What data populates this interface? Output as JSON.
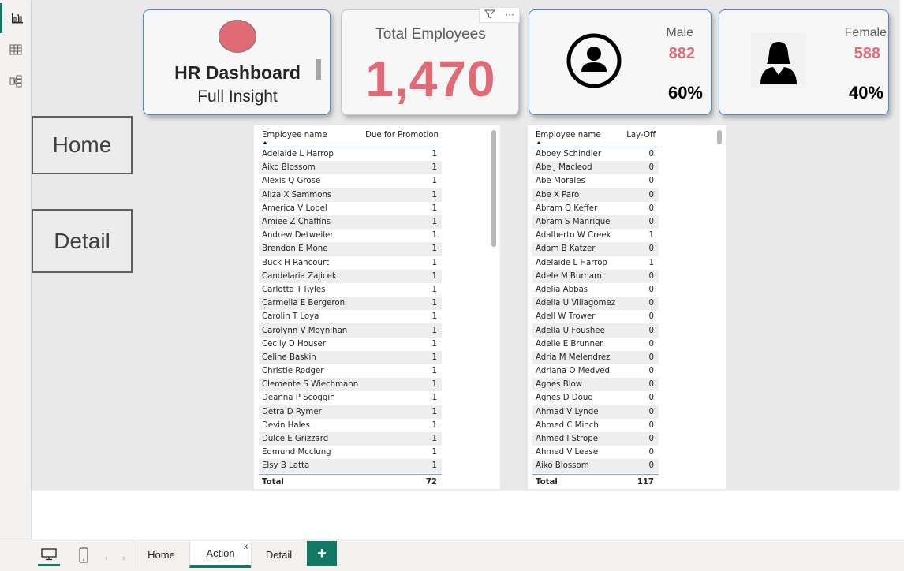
{
  "rail": {
    "icons": [
      "report-view-icon",
      "table-view-icon",
      "model-view-icon"
    ]
  },
  "title_card": {
    "title": "HR Dashboard",
    "subtitle": "Full Insight"
  },
  "total_card": {
    "label": "Total Employees",
    "value": "1,470",
    "tools": {
      "filter_icon": "filter-icon",
      "more_icon": "more-options-icon",
      "more_label": "···"
    }
  },
  "male_card": {
    "label": "Male",
    "count": "882",
    "percent": "60%",
    "icon": "male-user-icon"
  },
  "female_card": {
    "label": "Female",
    "count": "588",
    "percent": "40%",
    "icon": "female-user-icon"
  },
  "nav": {
    "home": "Home",
    "detail": "Detail"
  },
  "promotion_table": {
    "headers": [
      "Employee name",
      "Due for Promotion"
    ],
    "rows": [
      [
        "Adelaide L Harrop",
        "1"
      ],
      [
        "Aiko Blossom",
        "1"
      ],
      [
        "Alexis Q Grose",
        "1"
      ],
      [
        "Aliza X Sammons",
        "1"
      ],
      [
        "America V Lobel",
        "1"
      ],
      [
        "Amiee Z Chaffins",
        "1"
      ],
      [
        "Andrew Detweiler",
        "1"
      ],
      [
        "Brendon E Mone",
        "1"
      ],
      [
        "Buck H Rancourt",
        "1"
      ],
      [
        "Candelaria Zajicek",
        "1"
      ],
      [
        "Carlotta T Ryles",
        "1"
      ],
      [
        "Carmella E Bergeron",
        "1"
      ],
      [
        "Carolin T Loya",
        "1"
      ],
      [
        "Carolynn V Moynihan",
        "1"
      ],
      [
        "Cecily D Houser",
        "1"
      ],
      [
        "Celine Baskin",
        "1"
      ],
      [
        "Christie Rodger",
        "1"
      ],
      [
        "Clemente S Wiechmann",
        "1"
      ],
      [
        "Deanna P Scoggin",
        "1"
      ],
      [
        "Detra D Rymer",
        "1"
      ],
      [
        "Devin Hales",
        "1"
      ],
      [
        "Dulce E Grizzard",
        "1"
      ],
      [
        "Edmund Mcclung",
        "1"
      ],
      [
        "Elsy B Latta",
        "1"
      ]
    ],
    "total_label": "Total",
    "total_value": "72"
  },
  "layoff_table": {
    "headers": [
      "Employee name",
      "Lay-Off"
    ],
    "rows": [
      [
        "Abbey Schindler",
        "0"
      ],
      [
        "Abe J Macleod",
        "0"
      ],
      [
        "Abe Morales",
        "0"
      ],
      [
        "Abe X Paro",
        "0"
      ],
      [
        "Abram Q Keffer",
        "0"
      ],
      [
        "Abram S Manrique",
        "0"
      ],
      [
        "Adalberto W Creek",
        "1"
      ],
      [
        "Adam B Katzer",
        "0"
      ],
      [
        "Adelaide L Harrop",
        "1"
      ],
      [
        "Adele M Burnam",
        "0"
      ],
      [
        "Adelia Abbas",
        "0"
      ],
      [
        "Adelia U Villagomez",
        "0"
      ],
      [
        "Adell W Trower",
        "0"
      ],
      [
        "Adella U Foushee",
        "0"
      ],
      [
        "Adelle E Brunner",
        "0"
      ],
      [
        "Adria M Melendrez",
        "0"
      ],
      [
        "Adriana O Medved",
        "0"
      ],
      [
        "Agnes Blow",
        "0"
      ],
      [
        "Agnes D Doud",
        "0"
      ],
      [
        "Ahmad V Lynde",
        "0"
      ],
      [
        "Ahmed C Minch",
        "0"
      ],
      [
        "Ahmed I Strope",
        "0"
      ],
      [
        "Ahmed V Lease",
        "0"
      ],
      [
        "Aiko Blossom",
        "0"
      ]
    ],
    "total_label": "Total",
    "total_value": "117"
  },
  "tabs": {
    "home": "Home",
    "action": "Action",
    "detail": "Detail",
    "close": "x",
    "add": "+",
    "prev": "‹",
    "next": "›"
  },
  "colors": {
    "accent_pink": "#e06a75",
    "powerbi_green": "#117865",
    "card_border": "#4a8ad6"
  }
}
